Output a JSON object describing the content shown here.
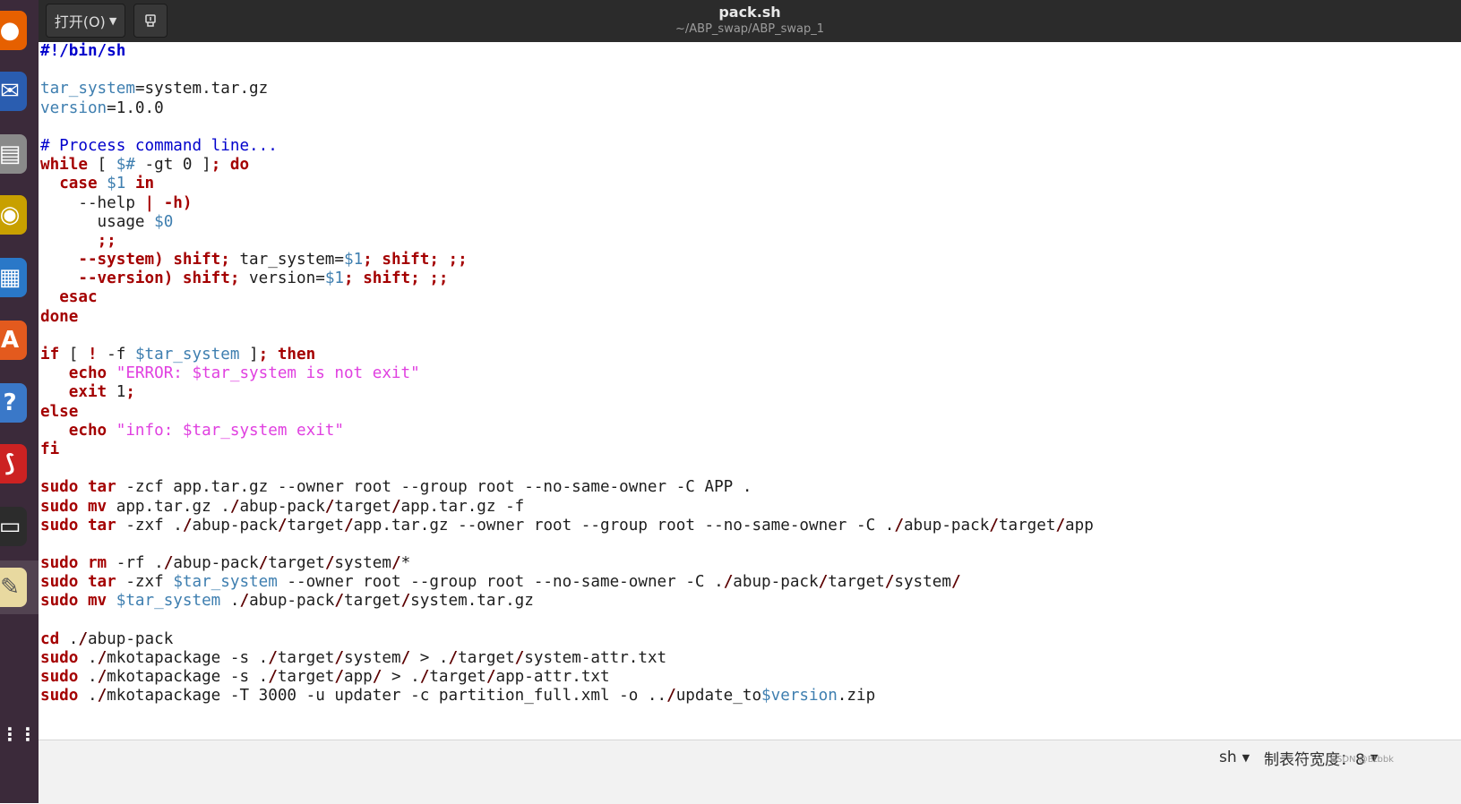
{
  "window": {
    "title": "pack.sh",
    "path": "~/ABP_swap/ABP_swap_1"
  },
  "toolbar": {
    "open_label": "打开(O)",
    "open_icon": "chevron-down-icon",
    "pin_icon": "document-pin-icon"
  },
  "dock": {
    "apps": [
      {
        "name": "firefox",
        "icon": "firefox-icon",
        "color": "#e66000"
      },
      {
        "name": "thunderbird",
        "icon": "thunderbird-icon",
        "color": "#2a5db0"
      },
      {
        "name": "files",
        "icon": "files-icon",
        "color": "#8a8a8a"
      },
      {
        "name": "rhythmbox",
        "icon": "rhythmbox-icon",
        "color": "#c8a000"
      },
      {
        "name": "libreoffice-writer",
        "icon": "writer-icon",
        "color": "#2a78c8"
      },
      {
        "name": "ubuntu-software",
        "icon": "software-icon",
        "color": "#e35a1e"
      },
      {
        "name": "help",
        "icon": "help-icon",
        "color": "#3a78c8"
      },
      {
        "name": "document-viewer",
        "icon": "viewer-icon",
        "color": "#cc2222"
      },
      {
        "name": "terminal",
        "icon": "terminal-icon",
        "color": "#2c2c2c"
      },
      {
        "name": "text-editor",
        "icon": "text-editor-icon",
        "color": "#e8d9a0"
      },
      {
        "name": "show-applications",
        "icon": "app-grid-icon",
        "color": "#3b2a3a"
      }
    ]
  },
  "editor": {
    "lines": [
      "#!/bin/sh",
      "",
      "tar_system=system.tar.gz",
      "version=1.0.0",
      "",
      "# Process command line...",
      "while [ $# -gt 0 ]; do",
      "  case $1 in",
      "    --help | -h)",
      "      usage $0",
      "      ;;",
      "    --system) shift; tar_system=$1; shift; ;;",
      "    --version) shift; version=$1; shift; ;;",
      "  esac",
      "done",
      "",
      "if [ ! -f $tar_system ]; then",
      "   echo \"ERROR: $tar_system is not exit\"",
      "   exit 1;",
      "else",
      "   echo \"info: $tar_system exit\"",
      "fi",
      "",
      "sudo tar -zcf app.tar.gz --owner root --group root --no-same-owner -C APP .",
      "sudo mv app.tar.gz ./abup-pack/target/app.tar.gz -f",
      "sudo tar -zxf ./abup-pack/target/app.tar.gz --owner root --group root --no-same-owner -C ./abup-pack/target/app",
      "",
      "sudo rm -rf ./abup-pack/target/system/*",
      "sudo tar -zxf $tar_system --owner root --group root --no-same-owner -C ./abup-pack/target/system/",
      "sudo mv $tar_system ./abup-pack/target/system.tar.gz",
      "",
      "cd ./abup-pack",
      "sudo ./mkotapackage -s ./target/system/ > ./target/system-attr.txt",
      "sudo ./mkotapackage -s ./target/app/ > ./target/app-attr.txt",
      "sudo ./mkotapackage -T 3000 -u updater -c partition_full.xml -o ../update_to$version.zip"
    ]
  },
  "statusbar": {
    "language": "sh",
    "tab_width": "制表符宽度：8",
    "watermark": "CSDN @Btbbk"
  },
  "colors": {
    "keyword": "#a40000",
    "variable": "#3f7fb0",
    "comment": "#0000cc",
    "string": "#e040e0",
    "header_bg": "#2b2b2b",
    "dock_bg": "#3b2a3a"
  }
}
